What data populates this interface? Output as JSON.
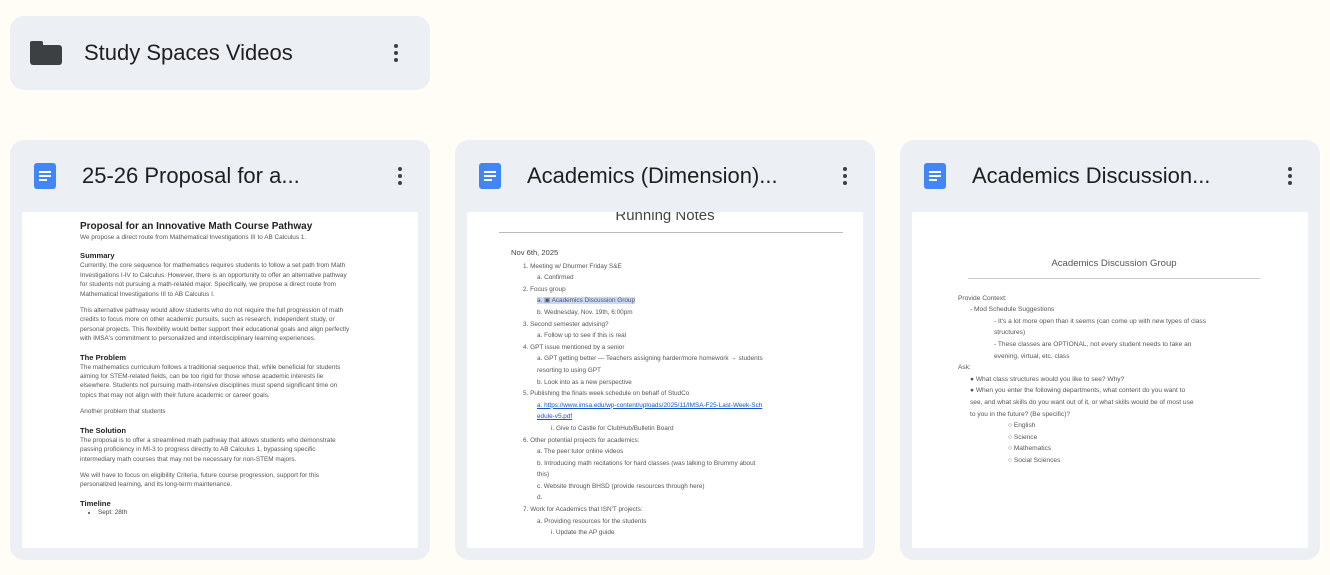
{
  "folder": {
    "name": "Study Spaces Videos",
    "icon": "folder-icon"
  },
  "docs": [
    {
      "title": "25-26 Proposal for a...",
      "preview": {
        "heading": "Proposal for an Innovative Math Course Pathway",
        "intro": "We propose a direct route from Mathematical Investigations III to AB Calculus 1.",
        "summary_title": "Summary",
        "summary_lines": [
          "Currently, the core sequence for mathematics requires students to follow a set path from Math",
          "Investigations I-IV to Calculus. However, there is an opportunity to offer an alternative pathway",
          "for students not pursuing a math-related major. Specifically, we propose a direct route from",
          "Mathematical Investigations III to AB Calculus I."
        ],
        "pathway_lines": [
          "This alternative pathway would allow students who do not require the full progression of math",
          "credits to focus more on other academic pursuits, such as research, independent study, or",
          "personal projects. This flexibility would better support their educational goals and align perfectly",
          "with IMSA's commitment to personalized and interdisciplinary learning experiences."
        ],
        "problem_title": "The Problem",
        "problem_lines": [
          "The mathematics curriculum follows a traditional sequence that, while beneficial for students",
          "aiming for STEM-related fields, can be too rigid for those whose academic interests lie",
          "elsewhere. Students not pursuing math-intensive disciplines must spend significant time on",
          "topics that may not align with their future academic or career goals."
        ],
        "another": "Another problem that students",
        "solution_title": "The Solution",
        "solution_lines": [
          "The proposal is to offer a streamlined math pathway that allows students who demonstrate",
          "passing proficiency in MI-3 to progress directly to AB Calculus 1, bypassing specific",
          "intermediary math courses that may not be necessary for non-STEM majors."
        ],
        "focus_lines": [
          "We will have to focus on eligibility Criteria, future course progression, support for this",
          "personalized learning, and its long-term maintenance."
        ],
        "timeline_title": "Timeline",
        "timeline_item": "Sept: 28th"
      }
    },
    {
      "title": "Academics (Dimension)...",
      "preview": {
        "title": "Running Notes",
        "date": "Nov 6th, 2025",
        "lines": [
          {
            "level": 1,
            "text": "1.   Meeting w/ Dhurmer Friday S&E"
          },
          {
            "level": 2,
            "text": "a.   Confirmed"
          },
          {
            "level": 1,
            "text": "2.   Focus group"
          },
          {
            "level": 2,
            "text": "a.   ▣ Academics Discussion Group",
            "highlight": true
          },
          {
            "level": 2,
            "text": "b.   Wednesday, Nov. 19th, 6:00pm"
          },
          {
            "level": 1,
            "text": "3.   Second semester advising?"
          },
          {
            "level": 2,
            "text": "a.   Follow up to see if this is real"
          },
          {
            "level": 1,
            "text": "4.   GPT issue mentioned by a senior"
          },
          {
            "level": 2,
            "text": "a.   GPT getting better — Teachers assigning harder/more homework → students"
          },
          {
            "level": 2,
            "text": "      resorting to using GPT"
          },
          {
            "level": 2,
            "text": "b.   Look into as a new perspective"
          },
          {
            "level": 1,
            "text": "5.   Publishing the finals week schedule on behalf of StudCo"
          },
          {
            "level": 2,
            "text": "a.   https://www.imsa.edu/wp-content/uploads/2025/11/IMSA-F25-Last-Week-Sch",
            "link": true
          },
          {
            "level": 2,
            "text": "      edule-v5.pdf",
            "link": true
          },
          {
            "level": 3,
            "text": "i.    Give to Castle for ClubHub/Bulletin Board"
          },
          {
            "level": 1,
            "text": "6.   Other potential projects for academics:"
          },
          {
            "level": 2,
            "text": "a.   The peer tutor online videos"
          },
          {
            "level": 2,
            "text": "b.   Introducing math recitations for hard classes (was talking to Brummy about"
          },
          {
            "level": 2,
            "text": "      this)"
          },
          {
            "level": 2,
            "text": "c.   Website through BHSD (provide resources through here)"
          },
          {
            "level": 2,
            "text": "d."
          },
          {
            "level": 1,
            "text": "7.   Work for Academics that ISN'T projects:"
          },
          {
            "level": 2,
            "text": "a.   Providing resources for the students"
          },
          {
            "level": 3,
            "text": "i.    Update the AP guide"
          }
        ]
      }
    },
    {
      "title": "Academics Discussion...",
      "preview": {
        "title": "Academics Discussion Group",
        "lines": [
          {
            "level": 0,
            "text": "Provide Context:"
          },
          {
            "level": 1,
            "text": "-    Mod Schedule Suggestions"
          },
          {
            "level": 2,
            "text": "-    It's a lot more open than it seems (can come up with new types of class"
          },
          {
            "level": 2,
            "text": "      structures)"
          },
          {
            "level": 2,
            "text": "-    These classes are OPTIONAL, not every student needs to take an"
          },
          {
            "level": 2,
            "text": "      evening, virtual, etc. class"
          },
          {
            "level": 0,
            "text": "Ask:"
          },
          {
            "level": 1,
            "text": "●   What class structures would you like to see? Why?"
          },
          {
            "level": 1,
            "text": "●   When you enter the following departments, what content do you want to"
          },
          {
            "level": 1,
            "text": "      see, and what skills do you want out of it, or what skills would be of most use"
          },
          {
            "level": 1,
            "text": "      to you in the future? (Be specific)?"
          },
          {
            "level": 3,
            "text": "○   English"
          },
          {
            "level": 3,
            "text": "○   Science"
          },
          {
            "level": 3,
            "text": "○   Mathematics"
          },
          {
            "level": 3,
            "text": "○   Social Sciences"
          }
        ]
      }
    }
  ]
}
